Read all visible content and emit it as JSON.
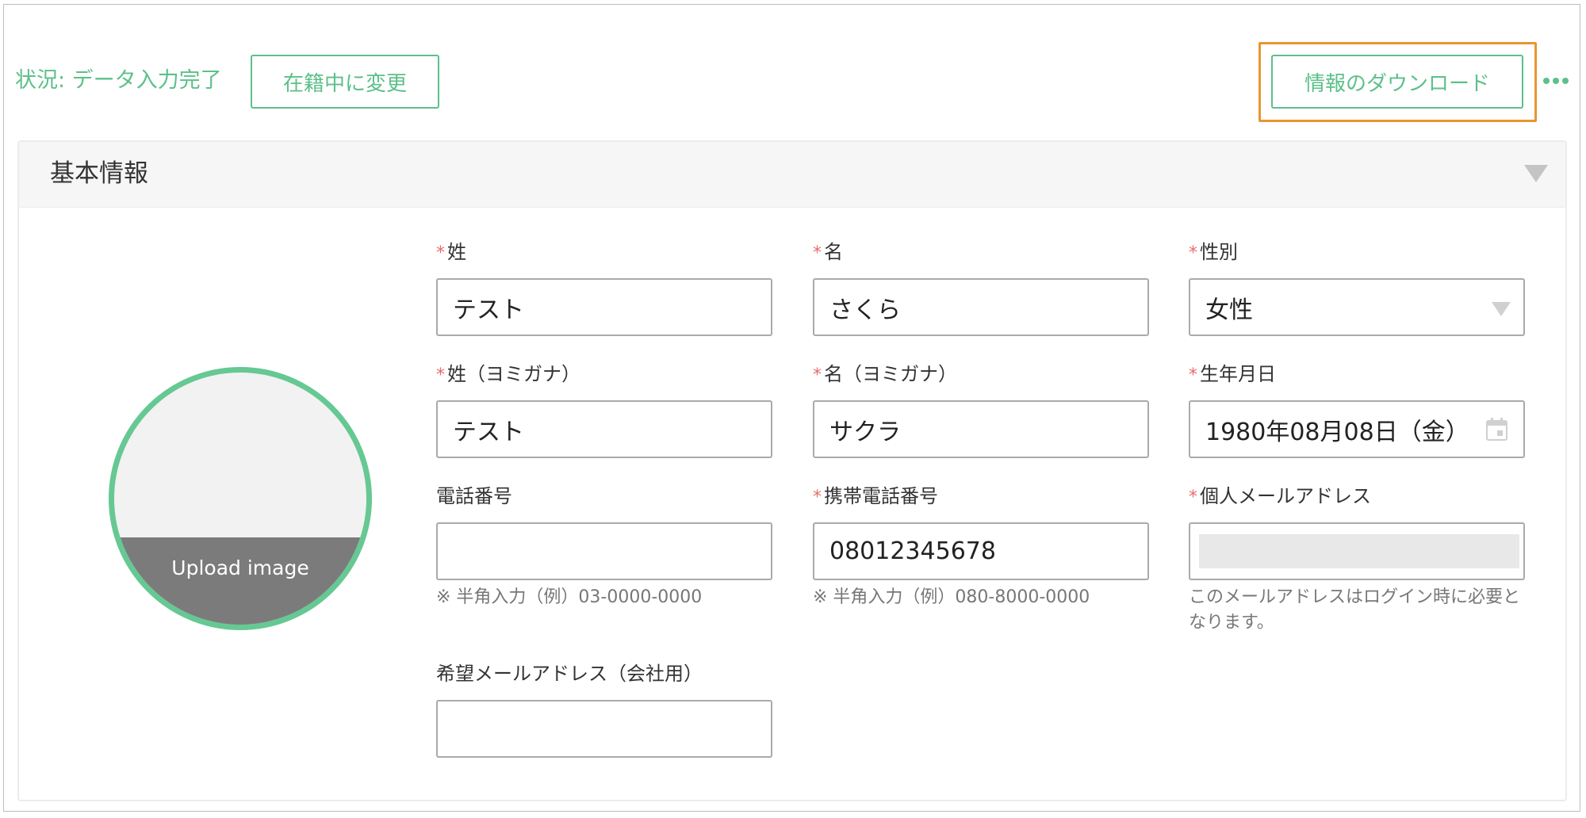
{
  "toolbar": {
    "status": "状況: データ入力完了",
    "change_button": "在籍中に変更",
    "download_button": "情報のダウンロード"
  },
  "section": {
    "title": "基本情報",
    "upload_label": "Upload image"
  },
  "fields": {
    "last_name": {
      "label": "姓",
      "value": "テスト"
    },
    "first_name": {
      "label": "名",
      "value": "さくら"
    },
    "gender": {
      "label": "性別",
      "value": "女性"
    },
    "last_name_kana": {
      "label": "姓（ヨミガナ）",
      "value": "テスト"
    },
    "first_name_kana": {
      "label": "名（ヨミガナ）",
      "value": "サクラ"
    },
    "birthdate": {
      "label": "生年月日",
      "value": "1980年08月08日（金）"
    },
    "phone": {
      "label": "電話番号",
      "value": "",
      "hint": "※ 半角入力（例）03-0000-0000"
    },
    "mobile": {
      "label": "携帯電話番号",
      "value": "08012345678",
      "hint": "※ 半角入力（例）080-8000-0000"
    },
    "personal_email": {
      "label": "個人メールアドレス",
      "value": "",
      "hint": "このメールアドレスはログイン時に必要となります。"
    },
    "company_email": {
      "label": "希望メールアドレス（会社用）",
      "value": ""
    }
  },
  "colors": {
    "accent": "#5cc08a",
    "highlight": "#e8962e",
    "required": "#e96c6c"
  }
}
